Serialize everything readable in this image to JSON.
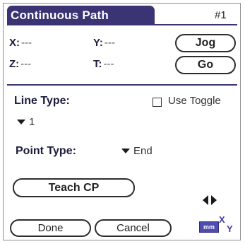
{
  "title": "Continuous Path",
  "page_indicator": "#1",
  "coords": {
    "x_label": "X:",
    "x_value": "---",
    "y_label": "Y:",
    "y_value": "---",
    "z_label": "Z:",
    "z_value": "---",
    "t_label": "T:",
    "t_value": "---"
  },
  "buttons": {
    "jog": "Jog",
    "go": "Go",
    "teach_cp": "Teach CP",
    "done": "Done",
    "cancel": "Cancel"
  },
  "line_type": {
    "label": "Line Type:",
    "value": "1"
  },
  "use_toggle": {
    "label": "Use Toggle",
    "checked": false
  },
  "point_type": {
    "label": "Point Type:",
    "value": "End"
  },
  "icons": {
    "units": "mm",
    "axes": "XY"
  },
  "colors": {
    "title_bar": "#3a3474",
    "units_icon": "#4f4cb0"
  }
}
